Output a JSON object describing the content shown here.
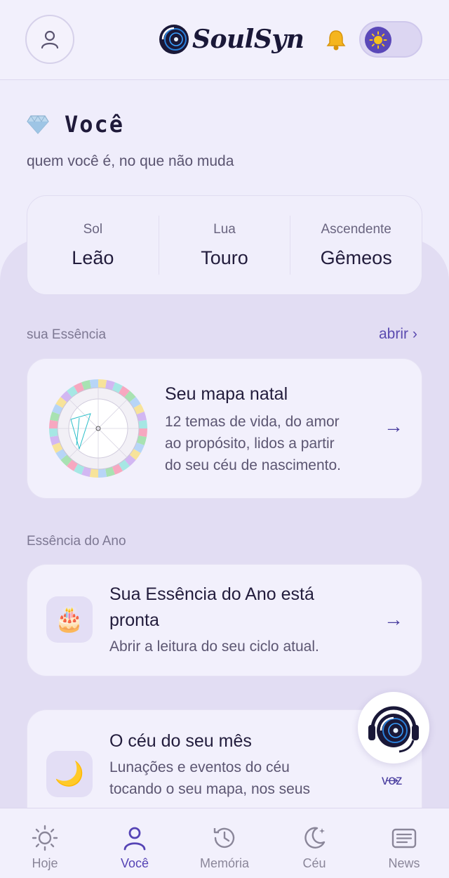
{
  "header": {
    "logo_text": "SoulSyn",
    "avatar_icon": "user-icon",
    "bell_icon": "bell-icon",
    "theme_icon": "sun-icon"
  },
  "page": {
    "title": "Você",
    "title_icon": "diamond-icon",
    "subtitle": "quem você é, no que não muda"
  },
  "big_three": [
    {
      "label": "Sol",
      "value": "Leão"
    },
    {
      "label": "Lua",
      "value": "Touro"
    },
    {
      "label": "Ascendente",
      "value": "Gêmeos"
    }
  ],
  "essence": {
    "label": "sua Essência",
    "open_link": "abrir ›",
    "card": {
      "title": "Seu mapa natal",
      "desc_lines": [
        "12 temas de vida, do amor",
        "ao propósito, lidos a partir",
        "do seu céu de nascimento."
      ],
      "arrow": "→"
    }
  },
  "year": {
    "label": "Essência do Ano",
    "card": {
      "title_lines": [
        "Sua Essência do Ano está",
        "pronta"
      ],
      "desc": "Abrir a leitura do seu ciclo atual.",
      "icon": "🎂",
      "arrow": "→"
    }
  },
  "month": {
    "card": {
      "title": "O céu do seu mês",
      "desc_lines": [
        "Lunações e eventos do céu",
        "tocando o seu mapa, nos seus"
      ],
      "icon": "🌙"
    }
  },
  "voice": {
    "label": "voz",
    "arrow": "→"
  },
  "nav": [
    {
      "label": "Hoje",
      "icon": "sun-icon",
      "active": false
    },
    {
      "label": "Você",
      "icon": "person-icon",
      "active": true
    },
    {
      "label": "Memória",
      "icon": "history-icon",
      "active": false
    },
    {
      "label": "Céu",
      "icon": "moon-icon",
      "active": false
    },
    {
      "label": "News",
      "icon": "news-icon",
      "active": false
    }
  ],
  "colors": {
    "accent": "#5543b5",
    "background": "#efedfb",
    "card": "#f2f0fc"
  }
}
